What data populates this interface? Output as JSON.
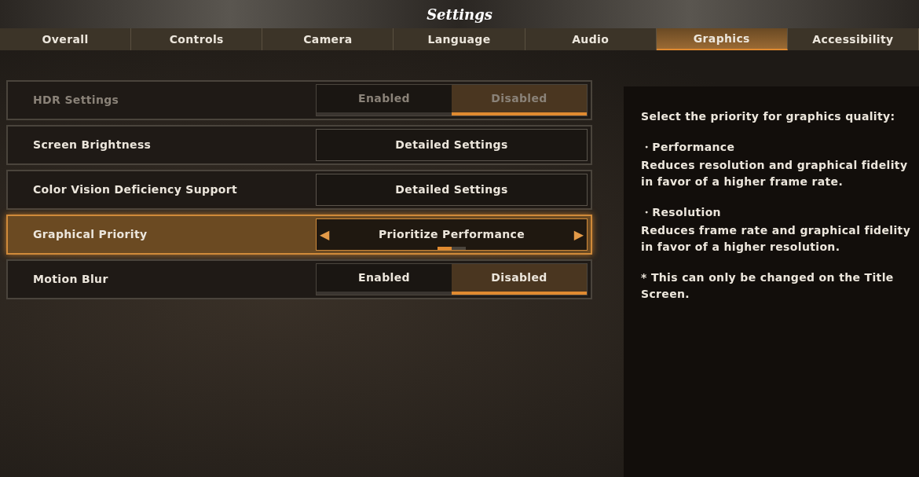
{
  "window": {
    "title": "Settings"
  },
  "tabs": [
    {
      "label": "Overall",
      "selected": false
    },
    {
      "label": "Controls",
      "selected": false
    },
    {
      "label": "Camera",
      "selected": false
    },
    {
      "label": "Language",
      "selected": false
    },
    {
      "label": "Audio",
      "selected": false
    },
    {
      "label": "Graphics",
      "selected": true
    },
    {
      "label": "Accessibility",
      "selected": false
    }
  ],
  "settings": [
    {
      "kind": "toggle",
      "label": "HDR Settings",
      "disabled": true,
      "selected": false,
      "options": [
        {
          "label": "Enabled",
          "selected": false
        },
        {
          "label": "Disabled",
          "selected": true
        }
      ]
    },
    {
      "kind": "button",
      "label": "Screen Brightness",
      "disabled": false,
      "selected": false,
      "value": "Detailed Settings"
    },
    {
      "kind": "button",
      "label": "Color Vision Deficiency Support",
      "disabled": false,
      "selected": false,
      "value": "Detailed Settings"
    },
    {
      "kind": "selector",
      "label": "Graphical Priority",
      "disabled": false,
      "selected": true,
      "value": "Prioritize Performance",
      "left_arrow": "◀",
      "right_arrow": "▶",
      "pages": [
        {
          "selected": true
        },
        {
          "selected": false
        }
      ]
    },
    {
      "kind": "toggle",
      "label": "Motion Blur",
      "disabled": false,
      "selected": false,
      "options": [
        {
          "label": "Enabled",
          "selected": false
        },
        {
          "label": "Disabled",
          "selected": true
        }
      ]
    }
  ],
  "description": [
    "Select the priority for graphics quality:",
    "・Performance",
    "Reduces resolution and graphical fidelity in favor of a higher frame rate.",
    "・Resolution",
    "Reduces frame rate and graphical fidelity in favor of a higher resolution.",
    "* This can only be changed on the Title Screen."
  ]
}
